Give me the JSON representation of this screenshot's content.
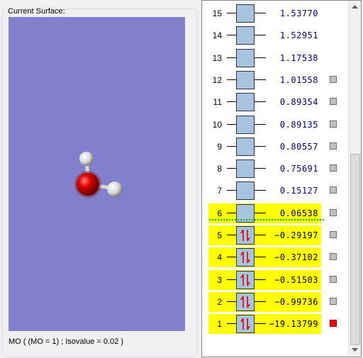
{
  "surface": {
    "group_title": "Current Surface:",
    "status": "MO ( (MO = 1) ; Isovalue = 0.02 )"
  },
  "colors": {
    "viewer_bg": "#8080cc",
    "highlight": "#ffff00",
    "orbital_box": "#a6c4e0",
    "checkbox_selected": "#ff0000",
    "homo_lumo_separator": "#00c000"
  },
  "orbitals": [
    {
      "num": "15",
      "energy": "1.53770",
      "occupied": false,
      "highlight": false,
      "checkbox": "none"
    },
    {
      "num": "14",
      "energy": "1.52951",
      "occupied": false,
      "highlight": false,
      "checkbox": "none"
    },
    {
      "num": "13",
      "energy": "1.17538",
      "occupied": false,
      "highlight": false,
      "checkbox": "none"
    },
    {
      "num": "12",
      "energy": "1.01558",
      "occupied": false,
      "highlight": false,
      "checkbox": "off"
    },
    {
      "num": "11",
      "energy": "0.89354",
      "occupied": false,
      "highlight": false,
      "checkbox": "off"
    },
    {
      "num": "10",
      "energy": "0.89135",
      "occupied": false,
      "highlight": false,
      "checkbox": "off"
    },
    {
      "num": "9",
      "energy": "0.80557",
      "occupied": false,
      "highlight": false,
      "checkbox": "off"
    },
    {
      "num": "8",
      "energy": "0.75691",
      "occupied": false,
      "highlight": false,
      "checkbox": "off"
    },
    {
      "num": "7",
      "energy": "0.15127",
      "occupied": false,
      "highlight": false,
      "checkbox": "off"
    },
    {
      "num": "6",
      "energy": "0.06538",
      "occupied": false,
      "highlight": true,
      "checkbox": "off"
    },
    {
      "num": "5",
      "energy": "−0.29197",
      "occupied": true,
      "highlight": true,
      "checkbox": "off"
    },
    {
      "num": "4",
      "energy": "−0.37102",
      "occupied": true,
      "highlight": true,
      "checkbox": "off"
    },
    {
      "num": "3",
      "energy": "−0.51503",
      "occupied": true,
      "highlight": true,
      "checkbox": "off"
    },
    {
      "num": "2",
      "energy": "−0.99736",
      "occupied": true,
      "highlight": true,
      "checkbox": "off"
    },
    {
      "num": "1",
      "energy": "−19.13799",
      "occupied": true,
      "highlight": true,
      "checkbox": "on"
    }
  ],
  "icons": {
    "scroll_up": "up-arrow-icon",
    "scroll_down": "down-arrow-icon",
    "electron_pair": "up-down-arrows-icon"
  }
}
